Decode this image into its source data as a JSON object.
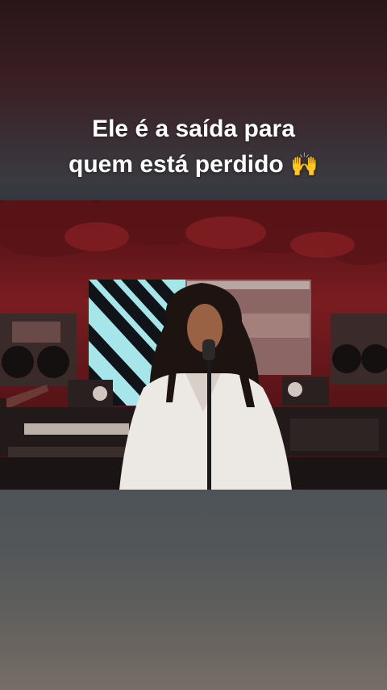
{
  "caption": {
    "line1": "Ele é a saída para",
    "line2": "quem está perdido",
    "emoji": "🙌",
    "emoji_name": "raising-hands-emoji"
  },
  "video": {
    "description_icon": "video-frame",
    "colors": {
      "studio_red": "#8a1e22",
      "screen_cyan": "#9fe0e6",
      "shirt_white": "#ece8e4",
      "hair_dark": "#1d1412"
    }
  }
}
